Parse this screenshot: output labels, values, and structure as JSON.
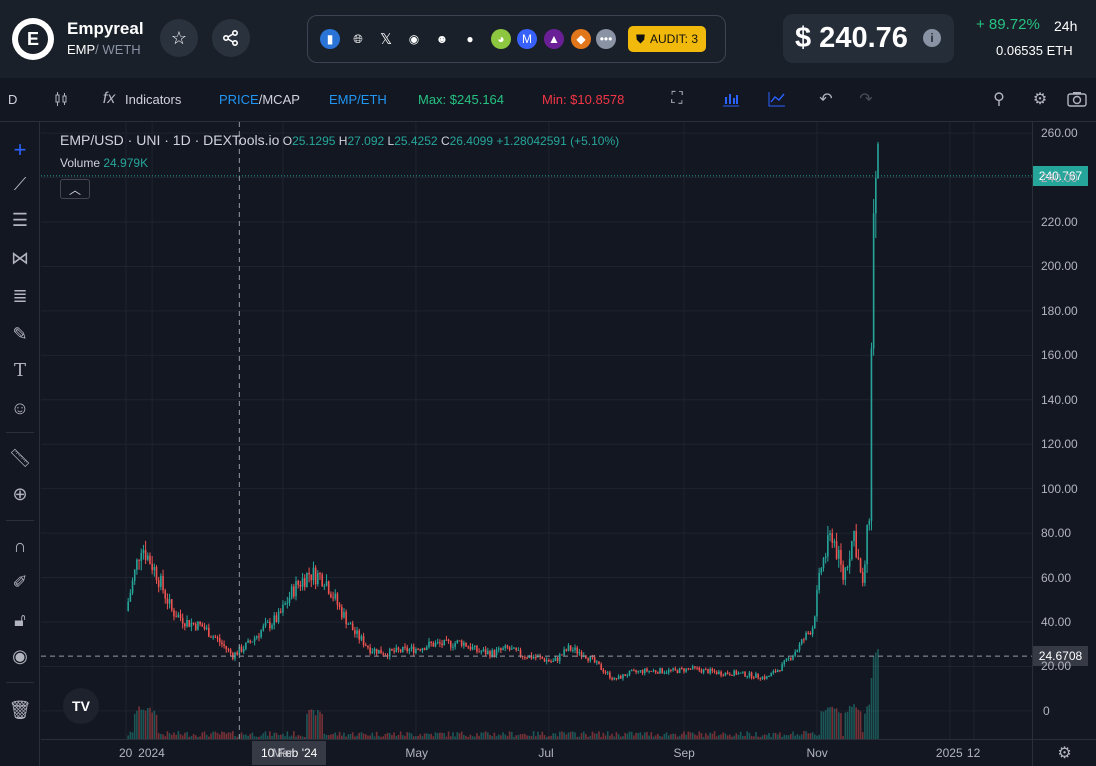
{
  "header": {
    "token_name": "Empyreal",
    "token_symbol": "EMP",
    "pair_sep": "/",
    "quote_symbol": "WETH",
    "audit_label": "AUDIT: 3",
    "price": "$ 240.76",
    "change": "+ 89.72%",
    "period": "24h",
    "eth_price": "0.06535  ETH",
    "social_icons": [
      "dextools-icon",
      "globe-icon",
      "x-icon",
      "discord-icon",
      "reddit-icon",
      "github-icon",
      "coingecko-icon",
      "coinmarketcap-icon",
      "dextscreener-icon",
      "metamask-icon",
      "more-icon"
    ]
  },
  "toolbar": {
    "interval": "D",
    "indicators": "Indicators",
    "price_label": "PRICE",
    "mcap_label": "/MCAP",
    "pair_toggle": "EMP/ETH",
    "max": "Max: $245.164",
    "min": "Min: $10.8578"
  },
  "legend": {
    "symbol": "EMP/USD · UNI · 1D · DEXTools.io",
    "o_key": "O",
    "o": "25.1295",
    "h_key": "H",
    "h": "27.092",
    "l_key": "L",
    "l": "25.4252",
    "c_key": "C",
    "c": "26.4099",
    "chg": "+1.28042591 (+5.10%)",
    "volume_key": "Volume",
    "volume": "24.979K"
  },
  "crosshair": {
    "date_label": "10 Feb '24",
    "price_label": "24.6708",
    "price_value": 24.67
  },
  "last_price": {
    "label": "240.767",
    "value": 240.767
  },
  "colors": {
    "up": "#26a69a",
    "down": "#ef5350",
    "accent_blue": "#2962ff",
    "max_green": "#26c281",
    "min_red": "#f23645",
    "audit_yellow": "#f0b90b"
  },
  "chart_data": {
    "type": "candlestick",
    "title": "EMP/USD · UNI · 1D · DEXTools.io",
    "ylim": [
      -5,
      265
    ],
    "y_ticks": [
      "0",
      "20.00",
      "40.00",
      "60.00",
      "80.00",
      "100.00",
      "120.00",
      "140.00",
      "160.00",
      "180.00",
      "200.00",
      "220.00",
      "240.00",
      "260.00"
    ],
    "x_ticks": [
      "20",
      "2024",
      "Mar",
      "May",
      "Jul",
      "Sep",
      "Nov",
      "2025",
      "12"
    ],
    "series": [
      {
        "name": "EMP/USD",
        "x": [
          "2023-12-20",
          "2023-12-27",
          "2024-01-03",
          "2024-01-10",
          "2024-01-17",
          "2024-01-24",
          "2024-01-31",
          "2024-02-07",
          "2024-02-14",
          "2024-02-21",
          "2024-02-28",
          "2024-03-06",
          "2024-03-13",
          "2024-03-20",
          "2024-03-27",
          "2024-04-03",
          "2024-04-10",
          "2024-04-17",
          "2024-04-24",
          "2024-05-01",
          "2024-05-08",
          "2024-05-15",
          "2024-05-22",
          "2024-05-29",
          "2024-06-05",
          "2024-06-12",
          "2024-06-19",
          "2024-06-26",
          "2024-07-03",
          "2024-07-10",
          "2024-07-17",
          "2024-07-24",
          "2024-07-31",
          "2024-08-07",
          "2024-08-14",
          "2024-08-21",
          "2024-08-28",
          "2024-09-04",
          "2024-09-11",
          "2024-09-18",
          "2024-09-25",
          "2024-10-02",
          "2024-10-09",
          "2024-10-16",
          "2024-10-23",
          "2024-10-30",
          "2024-11-03",
          "2024-11-08",
          "2024-11-13",
          "2024-11-18",
          "2024-11-22",
          "2024-11-25",
          "2024-11-27",
          "2024-11-29"
        ],
        "close": [
          45,
          75,
          62,
          45,
          40,
          38,
          32,
          25,
          30,
          37,
          42,
          55,
          62,
          60,
          46,
          35,
          28,
          26,
          27,
          28,
          30,
          30,
          31,
          27,
          26,
          28,
          25,
          24,
          22,
          28,
          26,
          20,
          14,
          17,
          18,
          18,
          18,
          19,
          18,
          17,
          17,
          16,
          15,
          20,
          28,
          38,
          65,
          80,
          60,
          80,
          55,
          90,
          230,
          240.767
        ]
      }
    ]
  }
}
